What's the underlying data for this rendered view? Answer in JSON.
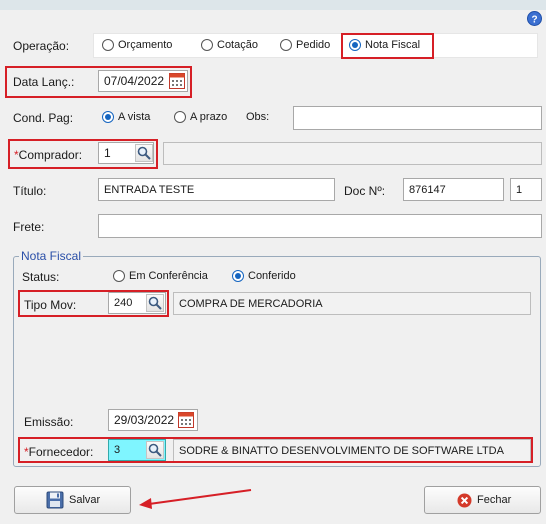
{
  "form": {
    "operacao": {
      "label": "Operação:",
      "options": [
        "Orçamento",
        "Cotação",
        "Pedido",
        "Nota Fiscal"
      ],
      "selected": "Nota Fiscal"
    },
    "data_lanc": {
      "label": "Data Lanç.:",
      "value": "07/04/2022"
    },
    "cond_pag": {
      "label": "Cond. Pag:",
      "options": [
        "A vista",
        "A prazo"
      ],
      "selected": "A vista"
    },
    "obs": {
      "label": "Obs:",
      "value": ""
    },
    "comprador": {
      "required_mark": "*",
      "label": "Comprador:",
      "value": "1",
      "description": ""
    },
    "titulo": {
      "label": "Título:",
      "value": "ENTRADA TESTE"
    },
    "doc": {
      "label": "Doc Nº:",
      "value": "876147",
      "serie": "1"
    },
    "frete": {
      "label": "Frete:",
      "value": ""
    }
  },
  "nota_fiscal": {
    "legend": "Nota Fiscal",
    "status": {
      "label": "Status:",
      "options": [
        "Em Conferência",
        "Conferido"
      ],
      "selected": "Conferido"
    },
    "tipo_mov": {
      "label": "Tipo Mov:",
      "code": "240",
      "description": "COMPRA DE MERCADORIA"
    },
    "emissao": {
      "label": "Emissão:",
      "value": "29/03/2022"
    },
    "fornecedor": {
      "required_mark": "*",
      "label": "Fornecedor:",
      "code": "3",
      "description": "SODRE & BINATTO DESENVOLVIMENTO DE SOFTWARE LTDA"
    }
  },
  "buttons": {
    "save": "Salvar",
    "close": "Fechar"
  },
  "icons": {
    "help": "help-icon",
    "calendar": "calendar-icon",
    "search": "magnifier-icon",
    "save": "floppy-disk-icon",
    "close": "close-circle-icon"
  },
  "colors": {
    "highlight_red": "#d61f26",
    "radio_blue": "#1565c0",
    "group_legend": "#2a4fa8",
    "active_input": "#7ff5ff"
  }
}
